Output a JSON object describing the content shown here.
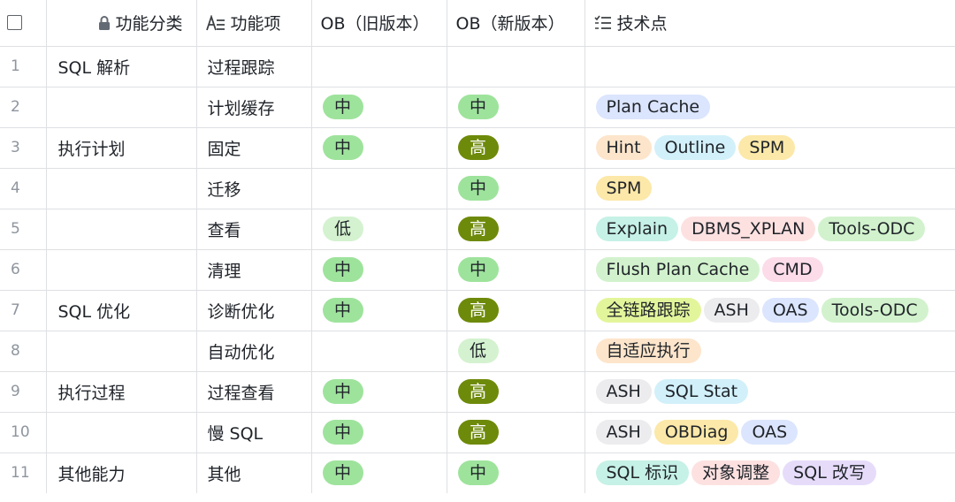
{
  "colors": {
    "level_mid": "#9ee39c",
    "level_high": "#6e8a0a",
    "level_low": "#d4f2cf",
    "grid": "#dee0e3",
    "row_index": "#8f959e"
  },
  "header": {
    "select_all_icon": "checkbox-icon",
    "category_icon": "lock-icon",
    "category": "功能分类",
    "feature_icon": "text-field-icon",
    "feature": "功能项",
    "old_version": "OB（旧版本）",
    "new_version": "OB（新版本）",
    "tech_icon": "list-icon",
    "tech": "技术点"
  },
  "rows": [
    {
      "index": "1",
      "category": "SQL 解析",
      "feature": "过程跟踪",
      "old": "",
      "new": "",
      "tech": []
    },
    {
      "index": "2",
      "category": "",
      "feature": "计划缓存",
      "old": "中",
      "new": "中",
      "tech": [
        {
          "label": "Plan Cache",
          "color": "blue"
        }
      ]
    },
    {
      "index": "3",
      "category": "执行计划",
      "feature": "固定",
      "old": "中",
      "new": "高",
      "tech": [
        {
          "label": "Hint",
          "color": "orange"
        },
        {
          "label": "Outline",
          "color": "cyan"
        },
        {
          "label": "SPM",
          "color": "yellow"
        }
      ]
    },
    {
      "index": "4",
      "category": "",
      "feature": "迁移",
      "old": "",
      "new": "中",
      "tech": [
        {
          "label": "SPM",
          "color": "yellow"
        }
      ]
    },
    {
      "index": "5",
      "category": "",
      "feature": "查看",
      "old": "低",
      "new": "高",
      "tech": [
        {
          "label": "Explain",
          "color": "teal"
        },
        {
          "label": "DBMS_XPLAN",
          "color": "pink"
        },
        {
          "label": "Tools-ODC",
          "color": "green"
        }
      ]
    },
    {
      "index": "6",
      "category": "",
      "feature": "清理",
      "old": "中",
      "new": "中",
      "tech": [
        {
          "label": "Flush Plan Cache",
          "color": "green"
        },
        {
          "label": "CMD",
          "color": "magenta"
        }
      ]
    },
    {
      "index": "7",
      "category": "SQL 优化",
      "feature": "诊断优化",
      "old": "中",
      "new": "高",
      "tech": [
        {
          "label": "全链路跟踪",
          "color": "lime"
        },
        {
          "label": "ASH",
          "color": "gray"
        },
        {
          "label": "OAS",
          "color": "blue"
        },
        {
          "label": "Tools-ODC",
          "color": "green"
        }
      ]
    },
    {
      "index": "8",
      "category": "",
      "feature": "自动优化",
      "old": "",
      "new": "低",
      "tech": [
        {
          "label": "自适应执行",
          "color": "orange"
        }
      ]
    },
    {
      "index": "9",
      "category": "执行过程",
      "feature": "过程查看",
      "old": "中",
      "new": "高",
      "tech": [
        {
          "label": "ASH",
          "color": "gray"
        },
        {
          "label": "SQL Stat",
          "color": "cyan"
        }
      ]
    },
    {
      "index": "10",
      "category": "",
      "feature": "慢 SQL",
      "old": "中",
      "new": "高",
      "tech": [
        {
          "label": "ASH",
          "color": "gray"
        },
        {
          "label": "OBDiag",
          "color": "yellow"
        },
        {
          "label": "OAS",
          "color": "blue"
        }
      ]
    },
    {
      "index": "11",
      "category": "其他能力",
      "feature": "其他",
      "old": "中",
      "new": "中",
      "tech": [
        {
          "label": "SQL 标识",
          "color": "teal"
        },
        {
          "label": "对象调整",
          "color": "pink"
        },
        {
          "label": "SQL 改写",
          "color": "purple"
        }
      ]
    }
  ]
}
